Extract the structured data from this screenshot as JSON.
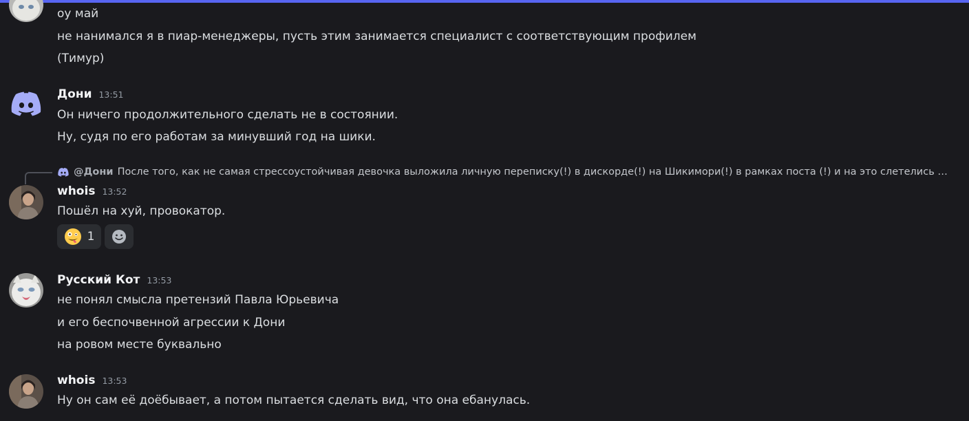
{
  "colors": {
    "background": "#1a1a1e",
    "accent": "#5865f2",
    "text": "#dbdee1",
    "username": "#f2f3f5",
    "timestamp": "#949ba4",
    "reaction_bg": "#2b2d31"
  },
  "messages": [
    {
      "author": "",
      "lines": [
        "оу май",
        "не нанимался я в пиар-менеджеры, пусть этим занимается специалист с соответствующим профилем",
        "(Тимур)"
      ]
    },
    {
      "author": "Дони",
      "time": "13:51",
      "avatar_icon": "discord-logo-icon",
      "lines": [
        "Он ничего продолжительного сделать не в состоянии.",
        "Ну, судя по его работам за минувший год на шики."
      ]
    },
    {
      "reply": {
        "icon": "discord-logo-icon",
        "author": "@Дони",
        "text": "После того, как не самая стрессоустойчивая девочка выложила личную переписку(!) в дискорде(!) на Шикимори(!) в рамках поста (!) и на это слетелись нед..."
      },
      "author": "whois",
      "time": "13:52",
      "lines": [
        "Пошёл на хуй, провокатор."
      ],
      "reactions": [
        {
          "emoji_icon": "zany-face-emoji-icon",
          "count": "1"
        },
        {
          "emoji_icon": "add-reaction-icon",
          "count": ""
        }
      ]
    },
    {
      "author": "Русский Кот",
      "time": "13:53",
      "lines": [
        "не понял смысла претензий Павла Юрьевича",
        "и его беспочвенной агрессии к Дони",
        "на ровом месте буквально"
      ]
    },
    {
      "author": "whois",
      "time": "13:53",
      "lines": [
        "Ну он сам её доёбывает, а потом пытается сделать вид, что она ебанулась."
      ]
    }
  ]
}
